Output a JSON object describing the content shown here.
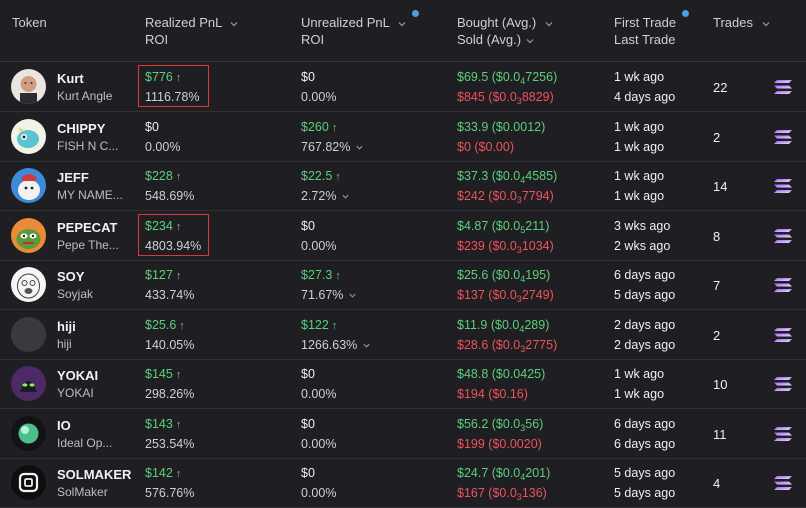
{
  "header": {
    "token": "Token",
    "realized_a": "Realized PnL",
    "realized_b": "ROI",
    "unrealized_a": "Unrealized PnL",
    "unrealized_b": "ROI",
    "bought": "Bought (Avg.)",
    "sold": "Sold (Avg.)",
    "first_trade": "First Trade",
    "last_trade": "Last Trade",
    "trades": "Trades"
  },
  "colors": {
    "positive": "#5ccf7a",
    "negative": "#f0525a",
    "highlight": "#d93a37",
    "sort_dot": "#4a9fdc"
  },
  "rows": [
    {
      "name": "Kurt",
      "sub": "Kurt Angle",
      "avatar": "kurt-angle-avatar",
      "realized": "$776",
      "realized_up": "↑",
      "realized_roi": "1116.78%",
      "unrealized": "$0",
      "unrealized_up": "",
      "unrealized_roi": "0.00%",
      "bought": "$69.5",
      "bought_avg_pre": "($0.0",
      "bought_avg_sub": "4",
      "bought_avg_post": "7256)",
      "sold": "$845",
      "sold_avg_pre": "($0.0",
      "sold_avg_sub": "3",
      "sold_avg_post": "8829)",
      "first": "1 wk ago",
      "last": "4 days ago",
      "trades": "22",
      "highlighted": true
    },
    {
      "name": "CHIPPY",
      "sub": "FISH N C...",
      "avatar": "chippy-avatar",
      "realized": "$0",
      "realized_up": "",
      "realized_roi": "0.00%",
      "unrealized": "$260",
      "unrealized_up": "↑",
      "unrealized_roi": "767.82%",
      "bought": "$33.9",
      "bought_avg_pre": "($0.0012)",
      "bought_avg_sub": "",
      "bought_avg_post": "",
      "sold": "$0",
      "sold_avg_pre": "($0.00)",
      "sold_avg_sub": "",
      "sold_avg_post": "",
      "first": "1 wk ago",
      "last": "1 wk ago",
      "trades": "2",
      "highlighted": false
    },
    {
      "name": "JEFF",
      "sub": "MY NAME...",
      "avatar": "jeff-avatar",
      "realized": "$228",
      "realized_up": "↑",
      "realized_roi": "548.69%",
      "unrealized": "$22.5",
      "unrealized_up": "↑",
      "unrealized_roi": "2.72%",
      "bought": "$37.3",
      "bought_avg_pre": "($0.0",
      "bought_avg_sub": "4",
      "bought_avg_post": "4585)",
      "sold": "$242",
      "sold_avg_pre": "($0.0",
      "sold_avg_sub": "3",
      "sold_avg_post": "7794)",
      "first": "1 wk ago",
      "last": "1 wk ago",
      "trades": "14",
      "highlighted": false
    },
    {
      "name": "PEPECAT",
      "sub": "Pepe The...",
      "avatar": "pepecat-avatar",
      "realized": "$234",
      "realized_up": "↑",
      "realized_roi": "4803.94%",
      "unrealized": "$0",
      "unrealized_up": "",
      "unrealized_roi": "0.00%",
      "bought": "$4.87",
      "bought_avg_pre": "($0.0",
      "bought_avg_sub": "5",
      "bought_avg_post": "211)",
      "sold": "$239",
      "sold_avg_pre": "($0.0",
      "sold_avg_sub": "3",
      "sold_avg_post": "1034)",
      "first": "3 wks ago",
      "last": "2 wks ago",
      "trades": "8",
      "highlighted": true
    },
    {
      "name": "SOY",
      "sub": "Soyjak",
      "avatar": "soyjak-avatar",
      "realized": "$127",
      "realized_up": "↑",
      "realized_roi": "433.74%",
      "unrealized": "$27.3",
      "unrealized_up": "↑",
      "unrealized_roi": "71.67%",
      "bought": "$25.6",
      "bought_avg_pre": "($0.0",
      "bought_avg_sub": "4",
      "bought_avg_post": "195)",
      "sold": "$137",
      "sold_avg_pre": "($0.0",
      "sold_avg_sub": "3",
      "sold_avg_post": "2749)",
      "first": "6 days ago",
      "last": "5 days ago",
      "trades": "7",
      "highlighted": false
    },
    {
      "name": "hiji",
      "sub": "hiji",
      "avatar": "hiji-avatar",
      "realized": "$25.6",
      "realized_up": "↑",
      "realized_roi": "140.05%",
      "unrealized": "$122",
      "unrealized_up": "↑",
      "unrealized_roi": "1266.63%",
      "bought": "$11.9",
      "bought_avg_pre": "($0.0",
      "bought_avg_sub": "4",
      "bought_avg_post": "289)",
      "sold": "$28.6",
      "sold_avg_pre": "($0.0",
      "sold_avg_sub": "3",
      "sold_avg_post": "2775)",
      "first": "2 days ago",
      "last": "2 days ago",
      "trades": "2",
      "highlighted": false
    },
    {
      "name": "YOKAI",
      "sub": "YOKAI",
      "avatar": "yokai-avatar",
      "realized": "$145",
      "realized_up": "↑",
      "realized_roi": "298.26%",
      "unrealized": "$0",
      "unrealized_up": "",
      "unrealized_roi": "0.00%",
      "bought": "$48.8",
      "bought_avg_pre": "($0.0425)",
      "bought_avg_sub": "",
      "bought_avg_post": "",
      "sold": "$194",
      "sold_avg_pre": "($0.16)",
      "sold_avg_sub": "",
      "sold_avg_post": "",
      "first": "1 wk ago",
      "last": "1 wk ago",
      "trades": "10",
      "highlighted": false
    },
    {
      "name": "IO",
      "sub": "Ideal Op...",
      "avatar": "io-avatar",
      "realized": "$143",
      "realized_up": "↑",
      "realized_roi": "253.54%",
      "unrealized": "$0",
      "unrealized_up": "",
      "unrealized_roi": "0.00%",
      "bought": "$56.2",
      "bought_avg_pre": "($0.0",
      "bought_avg_sub": "3",
      "bought_avg_post": "56)",
      "sold": "$199",
      "sold_avg_pre": "($0.0020)",
      "sold_avg_sub": "",
      "sold_avg_post": "",
      "first": "6 days ago",
      "last": "6 days ago",
      "trades": "11",
      "highlighted": false
    },
    {
      "name": "SOLMAKER",
      "sub": "SolMaker",
      "avatar": "solmaker-avatar",
      "realized": "$142",
      "realized_up": "↑",
      "realized_roi": "576.76%",
      "unrealized": "$0",
      "unrealized_up": "",
      "unrealized_roi": "0.00%",
      "bought": "$24.7",
      "bought_avg_pre": "($0.0",
      "bought_avg_sub": "4",
      "bought_avg_post": "201)",
      "sold": "$167",
      "sold_avg_pre": "($0.0",
      "sold_avg_sub": "3",
      "sold_avg_post": "136)",
      "first": "5 days ago",
      "last": "5 days ago",
      "trades": "4",
      "highlighted": false
    }
  ]
}
